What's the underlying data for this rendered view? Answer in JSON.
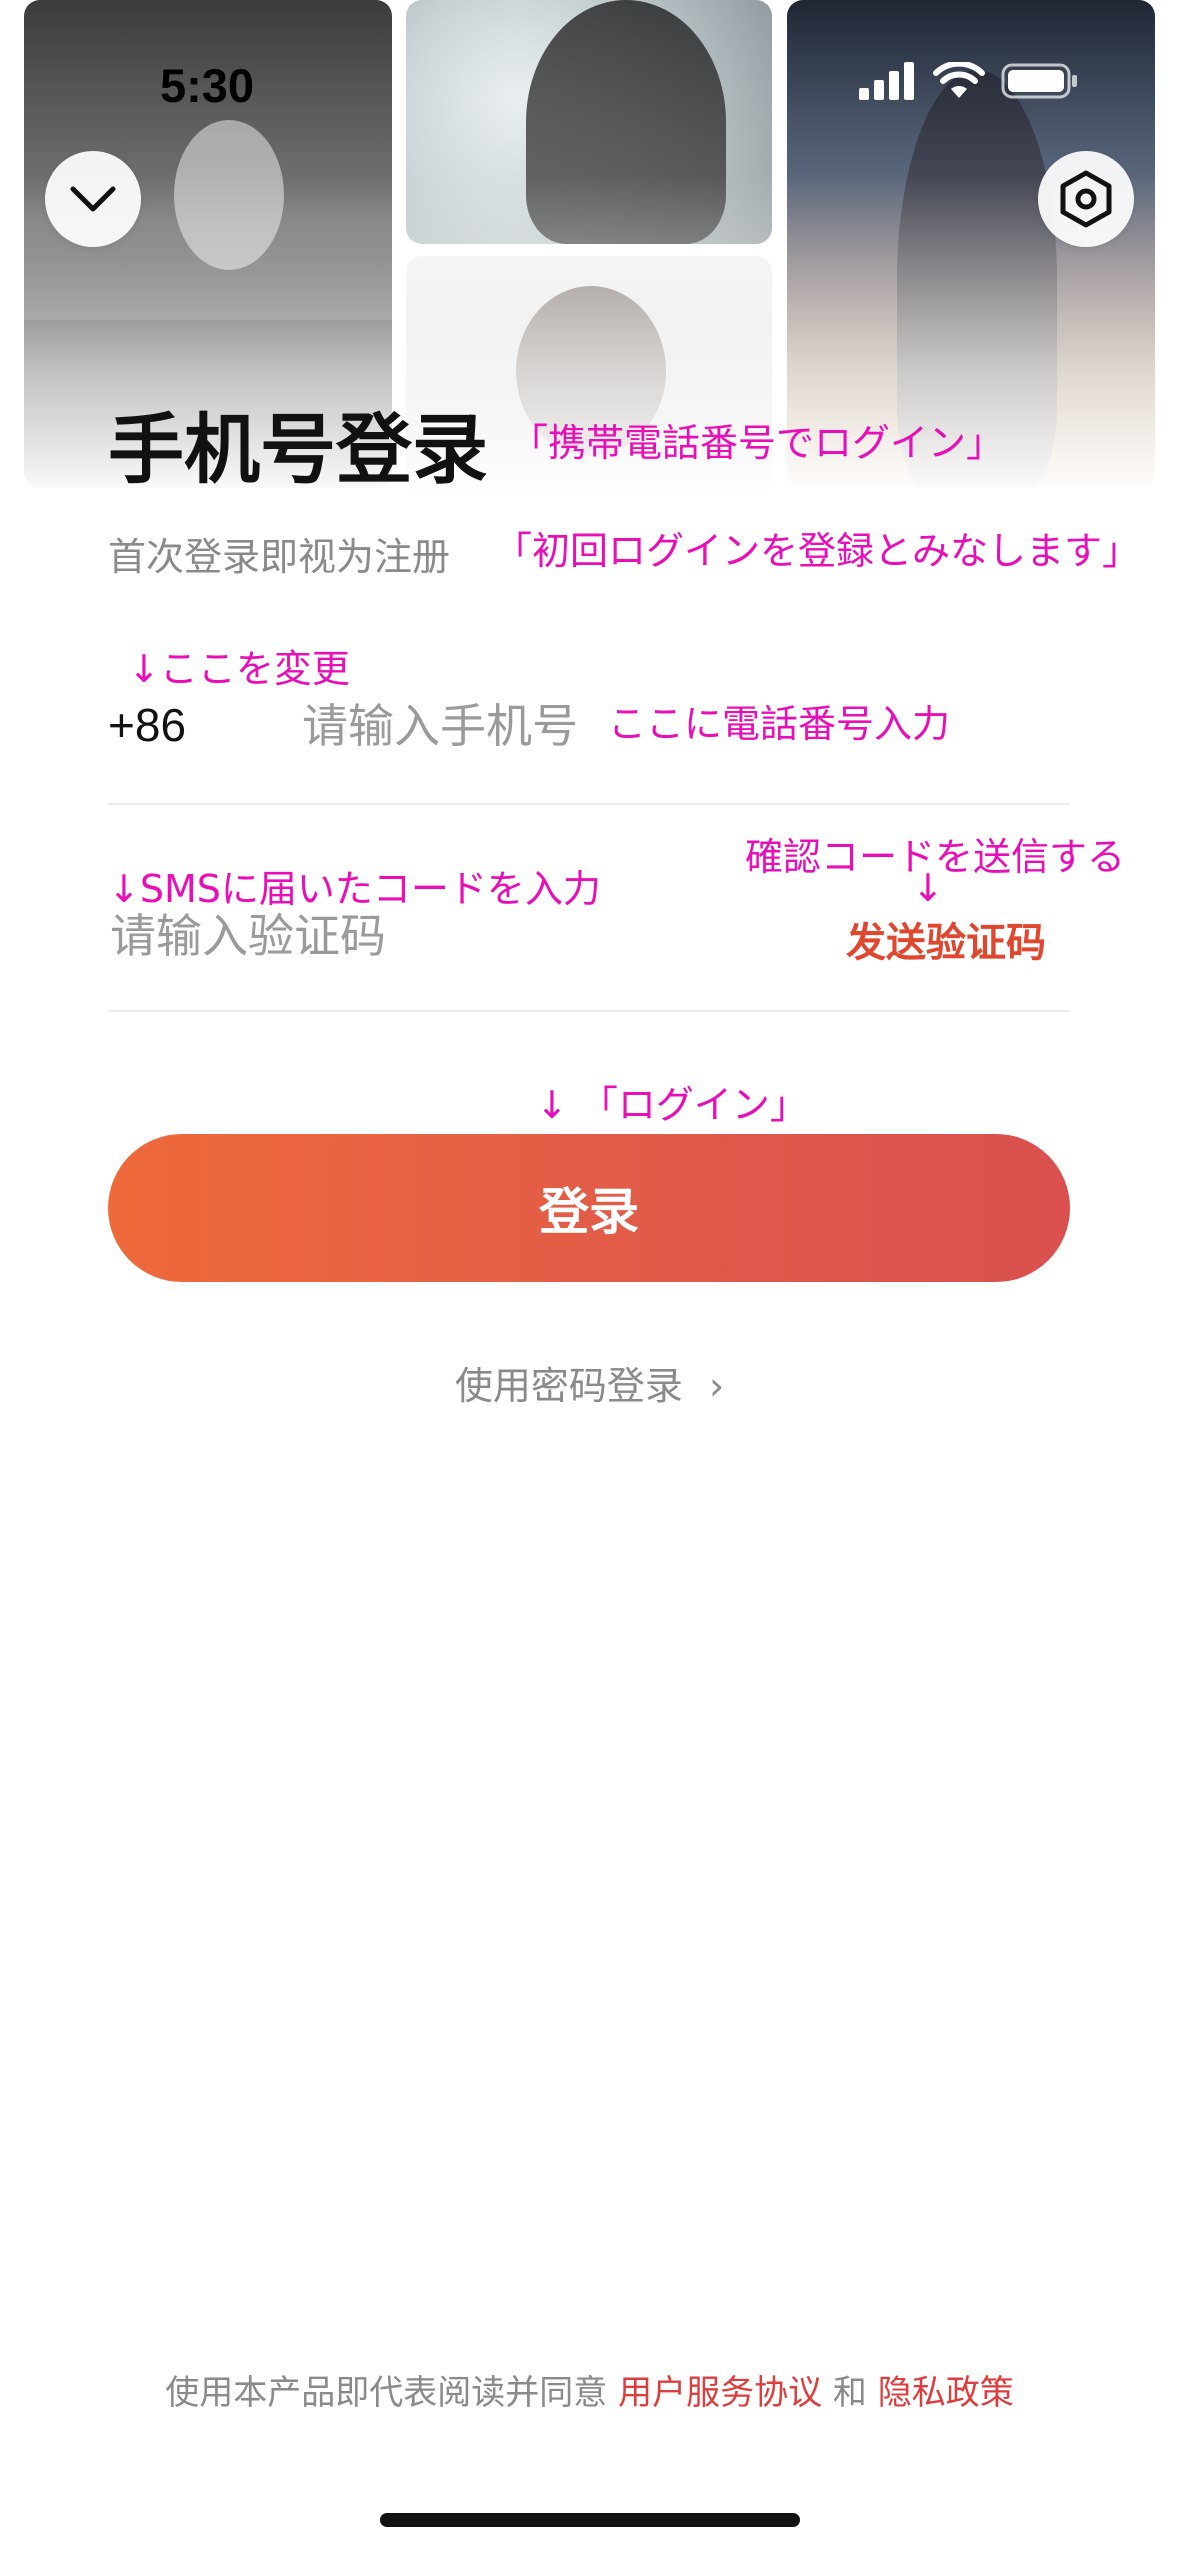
{
  "status_bar": {
    "time": "5:30"
  },
  "header": {
    "title": "手机号登录",
    "subtitle": "首次登录即视为注册"
  },
  "form": {
    "country_code": "+86",
    "phone_placeholder": "请输入手机号",
    "code_placeholder": "请输入验证码",
    "send_code_label": "发送验证码",
    "login_label": "登录",
    "password_login_label": "使用密码登录",
    "password_login_chevron": "›"
  },
  "agreement": {
    "prefix": "使用本产品即代表阅读并同意",
    "terms_link": "用户服务协议",
    "connector": "和",
    "privacy_link": "隐私政策"
  },
  "annotations": {
    "title_note": "「携帯電話番号でログイン」",
    "subtitle_note": "「初回ログインを登録とみなします」",
    "change_note": "↓ここを変更",
    "phone_note": "ここに電話番号入力",
    "sms_note": "↓SMSに届いたコードを入力",
    "send_code_note": "確認コードを送信する",
    "send_code_arrow": "↓",
    "login_note": "↓ 「ログイン」"
  },
  "icons": {
    "collapse": "chevron-down-icon",
    "settings": "hexagon-settings-icon",
    "signal": "signal-icon",
    "wifi": "wifi-icon",
    "battery": "battery-icon"
  },
  "colors": {
    "accent": "#e0472f",
    "link": "#dc3e3e",
    "annotation": "#e80fb8",
    "button_gradient_start": "#ee6a3a",
    "button_gradient_end": "#d9504f"
  }
}
